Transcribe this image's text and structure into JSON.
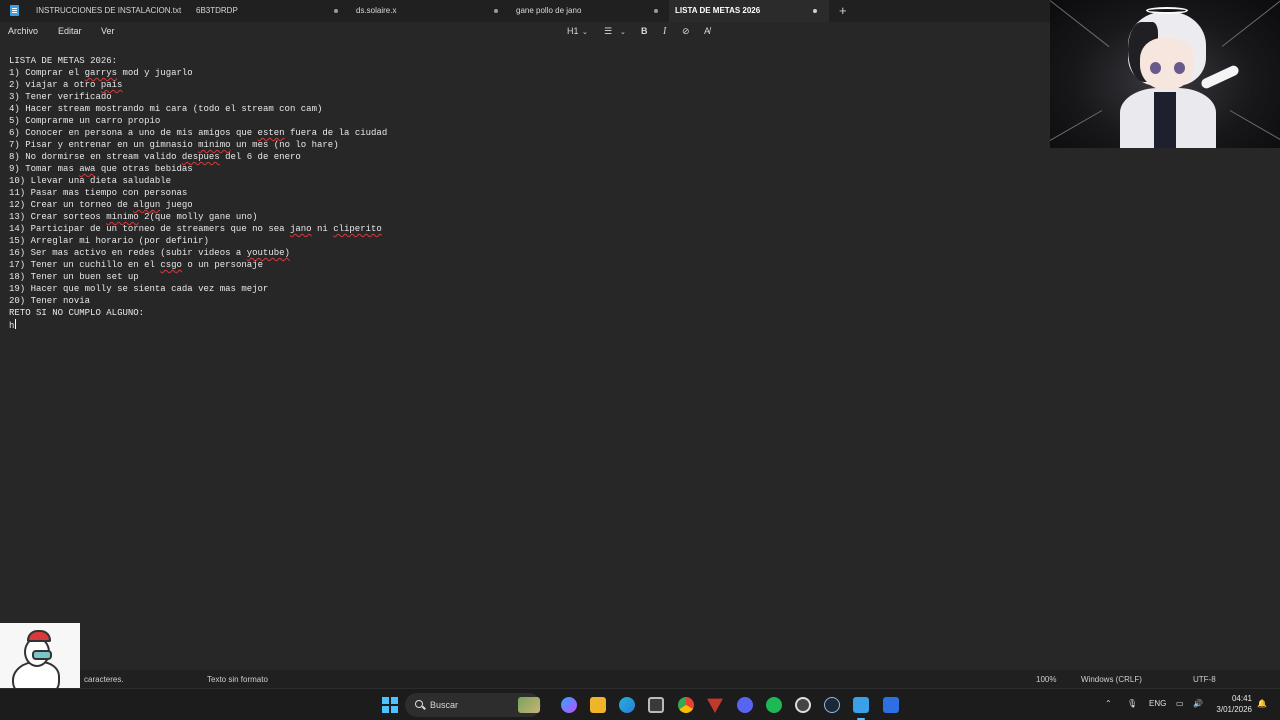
{
  "tabs": [
    {
      "label": "INSTRUCCIONES DE INSTALACION.txt",
      "modified": false
    },
    {
      "label": "6B3TDRDP",
      "modified": true
    },
    {
      "label": "ds.solaire.x",
      "modified": true
    },
    {
      "label": "gane pollo de jano",
      "modified": true
    },
    {
      "label": "LISTA DE METAS 2026",
      "modified": true,
      "active": true
    }
  ],
  "new_tab_label": "+",
  "menu": {
    "file": "Archivo",
    "edit": "Editar",
    "view": "Ver"
  },
  "toolbar": {
    "heading": "H1",
    "list": "☰",
    "bold": "B",
    "italic": "I",
    "link": "⊘",
    "clear": "A̸"
  },
  "document": {
    "lines": [
      "LISTA DE METAS 2026:",
      "1) Comprar el garrys mod y jugarlo",
      "2) viajar a otro pais",
      "3) Tener verificado",
      "4) Hacer stream mostrando mi cara (todo el stream con cam)",
      "5) Comprarme un carro propio",
      "6) Conocer en persona a uno de mis amigos que esten fuera de la ciudad",
      "7) Pisar y entrenar en un gimnasio minimo un mes (no lo hare)",
      "8) No dormirse en stream valido despues del 6 de enero",
      "9) Tomar mas awa que otras bebidas",
      "10) Llevar una dieta saludable",
      "11) Pasar mas tiempo con personas",
      "12) Crear un torneo de algun juego",
      "13) Crear sorteos minimo 2(que molly gane uno)",
      "14) Participar de un torneo de streamers que no sea jano ni cliperito",
      "15) Arreglar mi horario (por definir)",
      "16) Ser mas activo en redes (subir videos a youtube)",
      "17) Tener un cuchillo en el csgo o un personaje",
      "18) Tener un buen set up",
      "19) Hacer que molly se sienta cada vez mas mejor",
      "20) Tener novia",
      "RETO SI NO CUMPLO ALGUNO:",
      "h"
    ],
    "misspelled": [
      "garrys",
      "pais",
      "esten",
      "minimo",
      "despues",
      "awa",
      "algun",
      "jano",
      "cliperito",
      "youtube",
      "csgo"
    ]
  },
  "status": {
    "chars": "caracteres.",
    "format": "Texto sin formato",
    "zoom": "100%",
    "line_ending": "Windows (CRLF)",
    "encoding": "UTF-8"
  },
  "taskbar": {
    "search_placeholder": "Buscar",
    "language": "ENG",
    "time": "04:41",
    "date": "3/01/2026"
  },
  "colors": {
    "accent": "#4cc2ff",
    "spell_error": "#d9383a",
    "notepad_icon": "#3aa0e8"
  }
}
